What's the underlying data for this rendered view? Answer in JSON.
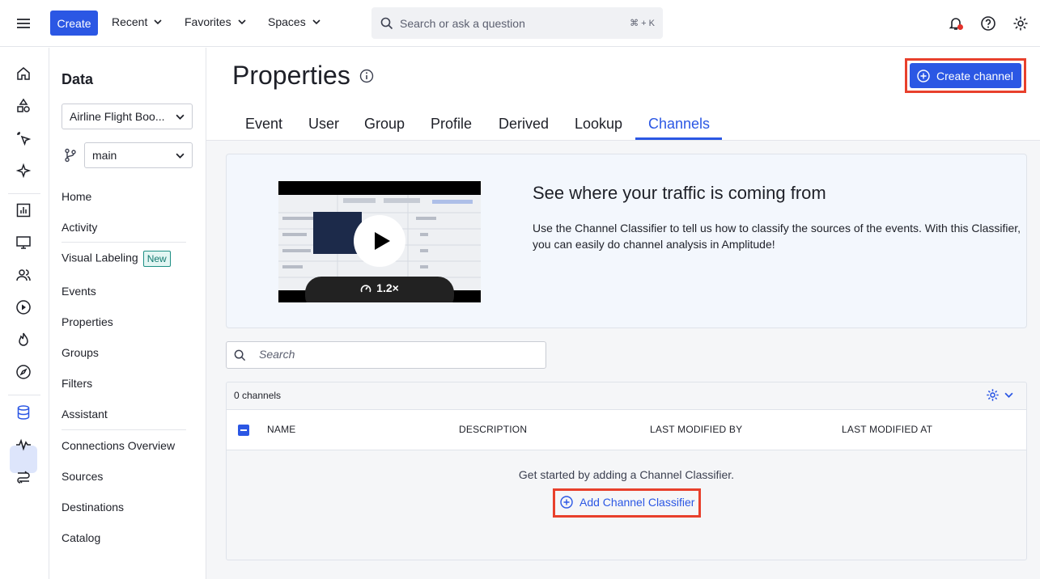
{
  "topbar": {
    "create_label": "Create",
    "recent_label": "Recent",
    "favorites_label": "Favorites",
    "spaces_label": "Spaces",
    "search_placeholder": "Search or ask a question",
    "search_shortcut": "⌘ + K"
  },
  "sidebar": {
    "title": "Data",
    "project": "Airline Flight Boo...",
    "branch": "main",
    "items": [
      {
        "label": "Home"
      },
      {
        "label": "Activity"
      },
      {
        "label": "Visual Labeling",
        "badge": "New"
      },
      {
        "label": "Events"
      },
      {
        "label": "Properties"
      },
      {
        "label": "Groups"
      },
      {
        "label": "Filters"
      },
      {
        "label": "Assistant"
      },
      {
        "label": "Connections Overview"
      },
      {
        "label": "Sources"
      },
      {
        "label": "Destinations"
      },
      {
        "label": "Catalog"
      }
    ]
  },
  "page": {
    "title": "Properties",
    "create_channel_label": "Create channel",
    "tabs": [
      "Event",
      "User",
      "Group",
      "Profile",
      "Derived",
      "Lookup",
      "Channels"
    ],
    "active_tab": "Channels"
  },
  "banner": {
    "title": "See where your traffic is coming from",
    "text": "Use the Channel Classifier to tell us how to classify the sources of the events. With this Classifier, you can easily do channel analysis in Amplitude!",
    "video_speed": "1.2×"
  },
  "table": {
    "search_placeholder": "Search",
    "count": "0 channels",
    "columns": [
      "NAME",
      "DESCRIPTION",
      "LAST MODIFIED BY",
      "LAST MODIFIED AT"
    ],
    "empty_text": "Get started by adding a Channel Classifier.",
    "add_label": "Add Channel Classifier"
  },
  "colors": {
    "accent": "#2b57e4",
    "highlight": "#e8402c",
    "notification": "#e4322b"
  }
}
